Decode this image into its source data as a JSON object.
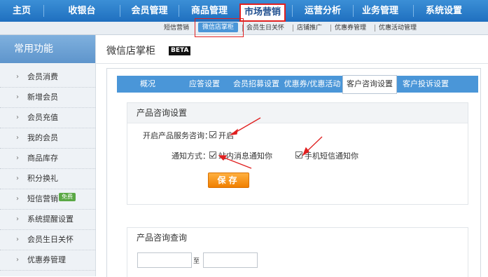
{
  "topnav": {
    "items": [
      "主页",
      "收银台",
      "会员管理",
      "商品管理",
      "市场营销",
      "运营分析",
      "业务管理",
      "系统设置"
    ],
    "active_index": 4
  },
  "subnav": {
    "items": [
      "短信营销",
      "微信店掌柜",
      "会员生日关怀",
      "店铺推广",
      "优惠券管理",
      "优惠活动管理"
    ],
    "active_index": 1
  },
  "sidebar": {
    "title": "常用功能",
    "items": [
      "会员消费",
      "新增会员",
      "会员充值",
      "我的会员",
      "商品库存",
      "积分换礼",
      "短信营销",
      "系统提醒设置",
      "会员生日关怀",
      "优惠券管理"
    ],
    "badge": "免费"
  },
  "page": {
    "title": "微信店掌柜",
    "beta": "BETA"
  },
  "tabs": [
    "概况",
    "应答设置",
    "会员招募设置",
    "优惠券/优惠活动",
    "客户咨询设置",
    "客户投诉设置"
  ],
  "settings": {
    "heading": "产品咨询设置",
    "enable_label": "开启产品服务咨询：",
    "enable_option": "开启",
    "notify_label": "通知方式：",
    "notify_site": "站内消息通知你",
    "notify_sms": "手机短信通知你",
    "save": "保存"
  },
  "query": {
    "heading": "产品咨询查询",
    "to": "至"
  },
  "colors": {
    "nav_blue": "#2b7fcc",
    "highlight_red": "#e02020",
    "save_orange": "#f28a0a",
    "badge_green": "#5aa845"
  }
}
